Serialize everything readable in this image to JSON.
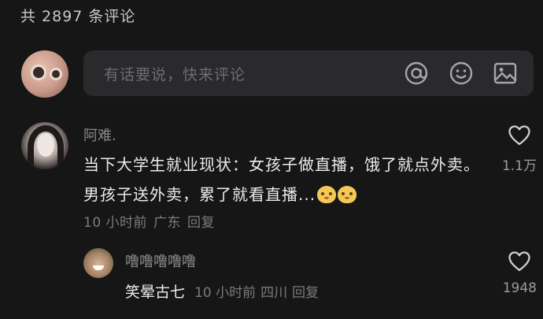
{
  "header": {
    "comment_count_text": "共 2897 条评论"
  },
  "input": {
    "placeholder": "有话要说，快来评论"
  },
  "comments": [
    {
      "username": "阿难.",
      "text_before_emoji": "当下大学生就业现状：女孩子做直播，饿了就点外卖。男孩子送外卖，累了就看直播...",
      "time": "10 小时前",
      "location": "广东",
      "reply_label": "回复",
      "likes": "1.1万"
    },
    {
      "username": "噜噜噜噜噜",
      "text": "笑晕古七",
      "time": "10 小时前",
      "location": "四川",
      "reply_label": "回复",
      "likes": "1948"
    }
  ],
  "icons": [
    "at-icon",
    "emoji-icon",
    "image-icon",
    "heart-icon"
  ]
}
